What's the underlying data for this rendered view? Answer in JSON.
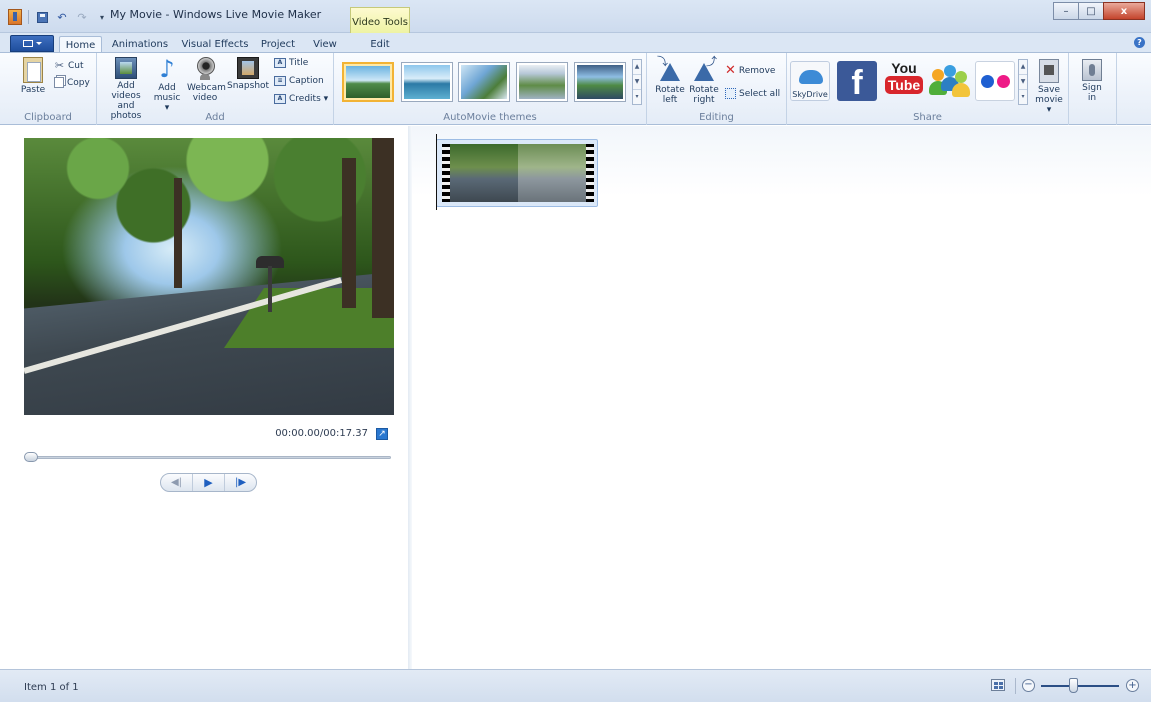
{
  "window": {
    "title": "My Movie - Windows Live Movie Maker",
    "contextual_tab": "Video Tools",
    "minimize": "–",
    "maximize": "□",
    "close": "x"
  },
  "tabs": [
    {
      "label": "Home",
      "active": true
    },
    {
      "label": "Animations",
      "active": false
    },
    {
      "label": "Visual Effects",
      "active": false
    },
    {
      "label": "Project",
      "active": false
    },
    {
      "label": "View",
      "active": false
    },
    {
      "label": "Edit",
      "active": false
    }
  ],
  "help": "?",
  "ribbon": {
    "clipboard": {
      "label": "Clipboard",
      "paste": "Paste",
      "cut": "Cut",
      "copy": "Copy"
    },
    "add": {
      "label": "Add",
      "add_videos_line1": "Add videos",
      "add_videos_line2": "and photos",
      "add_music_line1": "Add",
      "add_music_line2": "music ▾",
      "webcam_line1": "Webcam",
      "webcam_line2": "video",
      "snapshot": "Snapshot",
      "title": "Title",
      "caption": "Caption",
      "credits": "Credits ▾"
    },
    "automovie": {
      "label": "AutoMovie themes"
    },
    "editing": {
      "label": "Editing",
      "rotate_left_line1": "Rotate",
      "rotate_left_line2": "left",
      "rotate_right_line1": "Rotate",
      "rotate_right_line2": "right",
      "remove": "Remove",
      "select_all": "Select all"
    },
    "share": {
      "label": "Share",
      "skydrive": "SkyDrive",
      "facebook": "f",
      "youtube_line1": "You",
      "youtube_line2": "Tube",
      "save_movie_line1": "Save",
      "save_movie_line2": "movie ▾",
      "sign_in_line1": "Sign",
      "sign_in_line2": "in"
    }
  },
  "preview": {
    "timecode": "00:00.00/00:17.37",
    "fullscreen": "↗",
    "prev_frame": "◀|",
    "play": "▶",
    "next_frame": "|▶"
  },
  "status": {
    "text": "Item 1 of 1",
    "zoom_out": "−",
    "zoom_in": "+"
  },
  "colors": {
    "ribbon_border": "#a9bdd8",
    "selected_theme": "#f2b335",
    "accent_blue": "#2a78d0"
  }
}
